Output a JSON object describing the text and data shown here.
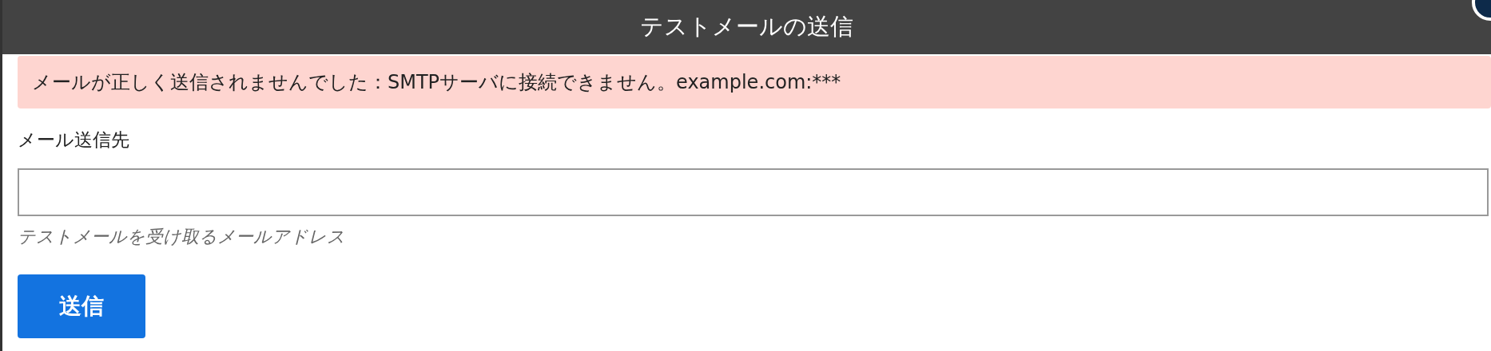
{
  "dialog": {
    "title": "テストメールの送信"
  },
  "alert": {
    "message": "メールが正しく送信されませんでした：SMTPサーバに接続できません。example.com:***"
  },
  "recipient_field": {
    "label": "メール送信先",
    "help": "テストメールを受け取るメールアドレス"
  },
  "buttons": [
    {
      "label": "送信",
      "kind": "primary"
    }
  ]
}
